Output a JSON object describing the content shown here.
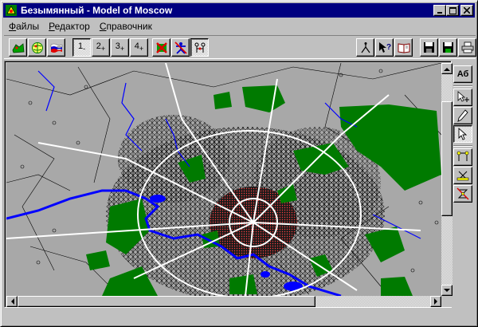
{
  "window": {
    "title": "Безымянный - Model of Moscow"
  },
  "menu": {
    "items": [
      {
        "accel": "Ф",
        "rest": "айлы"
      },
      {
        "accel": "Р",
        "rest": "едактор"
      },
      {
        "accel": "С",
        "rest": "правочник"
      }
    ]
  },
  "toolbar": {
    "zoom_levels": [
      {
        "num": "1",
        "sign": "-"
      },
      {
        "num": "2",
        "sign": "+"
      },
      {
        "num": "3",
        "sign": "+"
      },
      {
        "num": "4",
        "sign": "+"
      }
    ]
  },
  "palette": {
    "text_tool_label": "Аб"
  },
  "colors": {
    "map_bg": "#a8a8a8",
    "park": "#007a00",
    "water": "#0000ff",
    "road_major": "#ffffff",
    "street": "#000000",
    "center_red": "#ff0000"
  }
}
